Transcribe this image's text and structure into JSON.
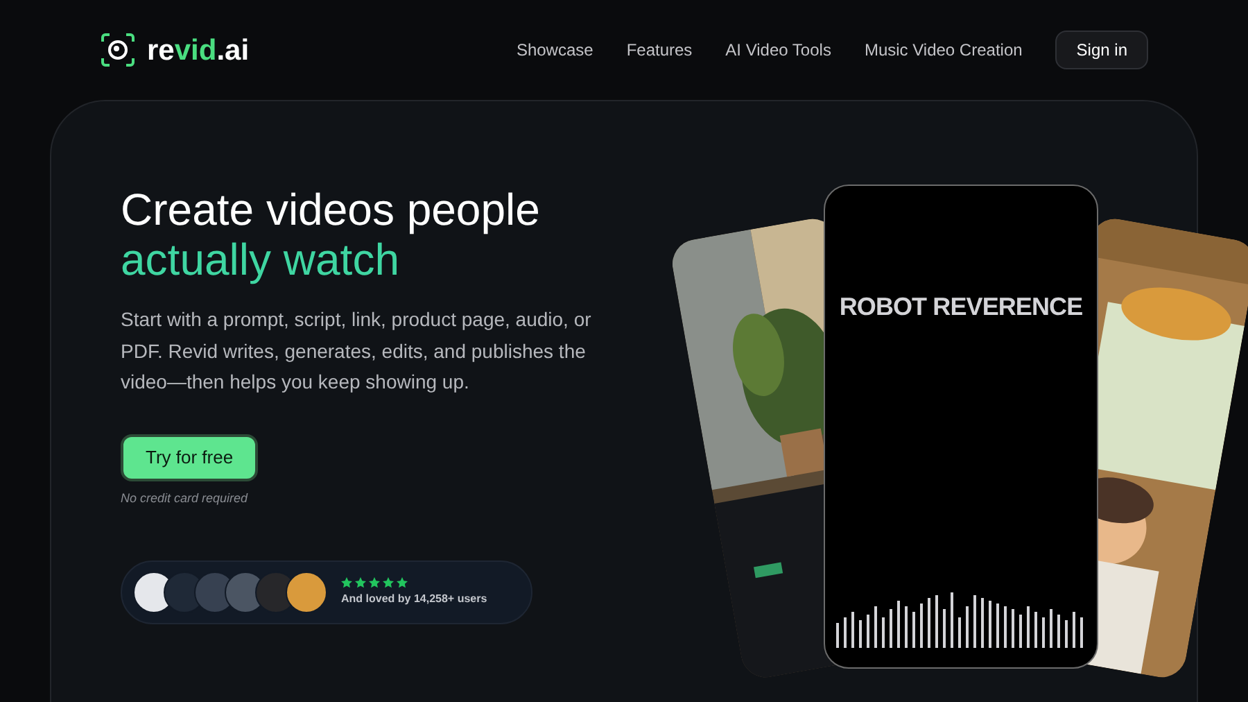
{
  "nav": {
    "logo": [
      {
        "text": "re",
        "accent": false
      },
      {
        "text": "vid",
        "accent": true
      },
      {
        "text": ".ai",
        "accent": false
      }
    ],
    "links": [
      "Showcase",
      "Features",
      "AI Video Tools",
      "Music Video Creation"
    ],
    "sign_in": "Sign in"
  },
  "hero": {
    "headline": "Create videos people",
    "headline_accent": "actually watch",
    "description": "Start with a prompt, script, link, product page, audio, or PDF. Revid writes, generates, edits, and publishes the video—then helps you keep showing up.",
    "cta": "Try for free",
    "cta_note": "No credit card required",
    "social_proof": {
      "avatars": [
        {
          "color": "#e5e7eb"
        },
        {
          "color": "#1f2937"
        },
        {
          "color": "#374151"
        },
        {
          "color": "#4b5563"
        },
        {
          "color": "#27272a"
        },
        {
          "color": "#d99a3c"
        }
      ],
      "stars": 5,
      "text": "And loved by 14,258+ users"
    }
  },
  "showcase": {
    "cards": [
      {
        "kind": "picture"
      },
      {
        "kind": "video",
        "title": "ROBOT REVERENCE"
      },
      {
        "kind": "picture"
      }
    ]
  }
}
